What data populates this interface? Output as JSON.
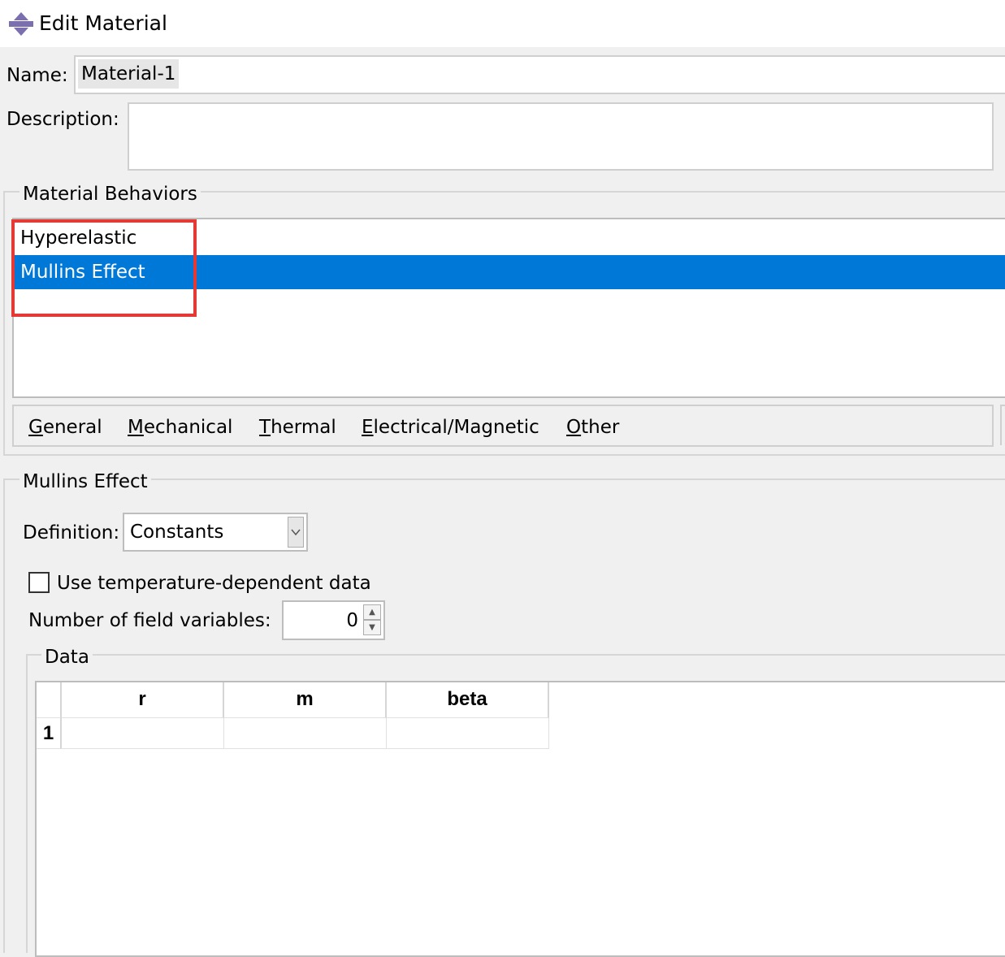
{
  "window": {
    "title": "Edit Material",
    "icon": "material-icon"
  },
  "name": {
    "label": "Name:",
    "value": "Material-1"
  },
  "description": {
    "label": "Description:",
    "value": ""
  },
  "behaviors": {
    "title": "Material Behaviors",
    "items": [
      "Hyperelastic",
      "Mullins Effect"
    ],
    "selected": "Mullins Effect"
  },
  "menus": [
    {
      "mnemonic": "G",
      "rest": "eneral"
    },
    {
      "mnemonic": "M",
      "rest": "echanical"
    },
    {
      "mnemonic": "T",
      "rest": "hermal"
    },
    {
      "mnemonic": "E",
      "rest": "lectrical/Magnetic"
    },
    {
      "mnemonic": "O",
      "rest": "ther"
    }
  ],
  "mullins": {
    "title": "Mullins Effect",
    "definition_label": "Definition:",
    "definition_value": "Constants",
    "temp_label": "Use temperature-dependent data",
    "temp_checked": false,
    "field_label": "Number of field variables:",
    "field_value": "0"
  },
  "data": {
    "title": "Data",
    "columns": [
      "r",
      "m",
      "beta"
    ],
    "rows": [
      {
        "index": "1",
        "values": [
          "",
          "",
          ""
        ]
      }
    ]
  },
  "colors": {
    "selection": "#0078d7",
    "highlight_box": "#e53935"
  }
}
